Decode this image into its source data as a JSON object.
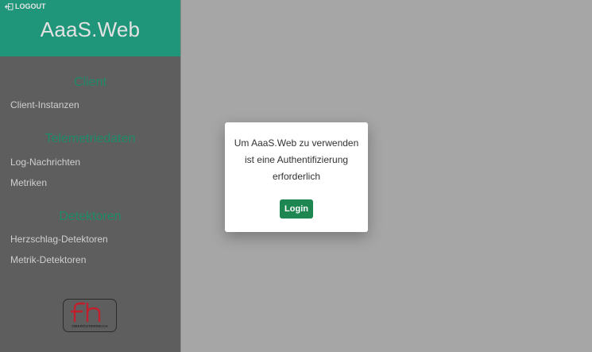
{
  "header": {
    "logout_label": "LOGOUT",
    "app_title": "AaaS.Web"
  },
  "sidebar": {
    "sections": [
      {
        "heading": "Client",
        "items": [
          "Client-Instanzen"
        ]
      },
      {
        "heading": "Telemetriedaten",
        "items": [
          "Log-Nachrichten",
          "Metriken"
        ]
      },
      {
        "heading": "Detektoren",
        "items": [
          "Herzschlag-Detektoren",
          "Metrik-Detektoren"
        ]
      }
    ],
    "logo": {
      "letters": "fh",
      "caption": "OBERÖSTERREICH"
    }
  },
  "dialog": {
    "message_lines": [
      "Um AaaS.Web zu verwenden",
      "ist eine Authentifizierung",
      "erforderlich"
    ],
    "login_label": "Login"
  },
  "colors": {
    "header_bg": "#1f9579",
    "sidebar_bg": "#5e5e5e",
    "section_heading": "#1f8a69",
    "login_button": "#1e8751",
    "logo_red": "#c0202c",
    "overlay_bg": "#a6a6a6"
  }
}
